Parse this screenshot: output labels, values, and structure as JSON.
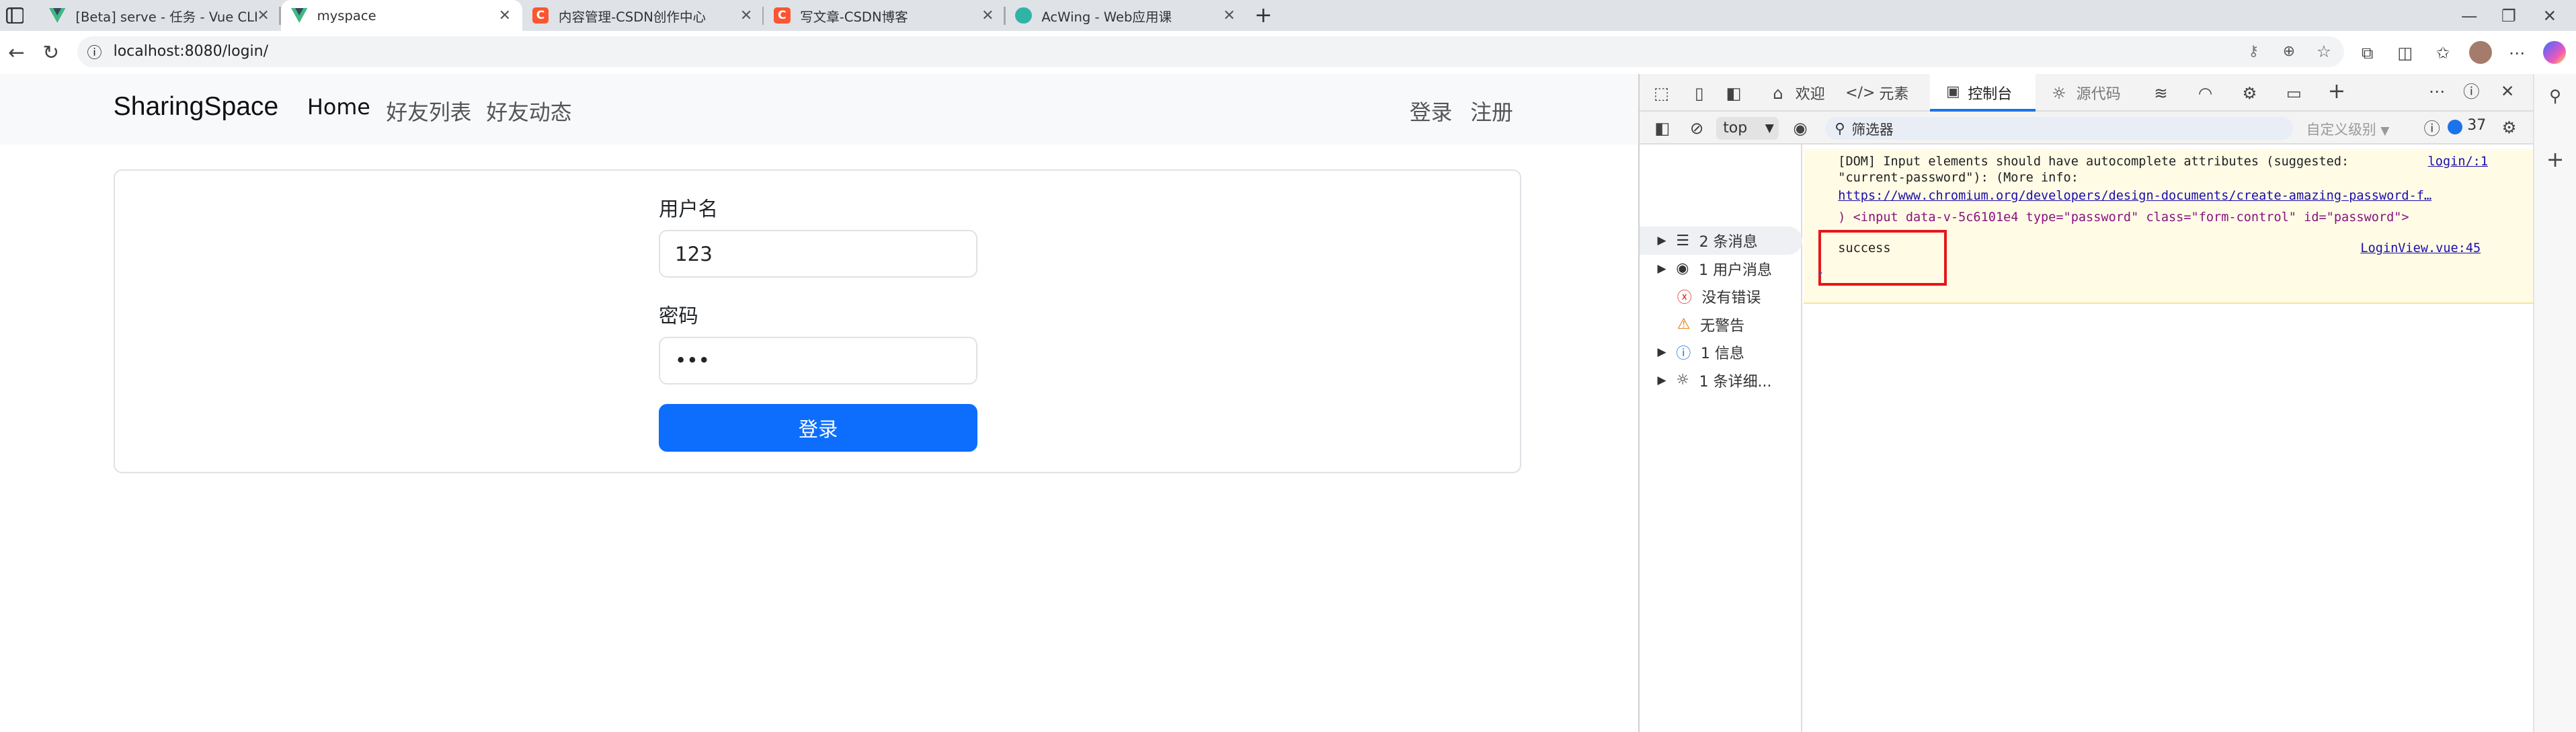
{
  "browser": {
    "tabs": [
      {
        "title": "[Beta] serve - 任务 - Vue CLI",
        "icon": "vue-icon"
      },
      {
        "title": "myspace",
        "icon": "vue-icon"
      },
      {
        "title": "内容管理-CSDN创作中心",
        "icon": "csdn-icon"
      },
      {
        "title": "写文章-CSDN博客",
        "icon": "csdn-icon"
      },
      {
        "title": "AcWing - Web应用课",
        "icon": "acwing-icon"
      }
    ],
    "csdn_letter": "C",
    "url": "localhost:8080/login/"
  },
  "page": {
    "brand": "SharingSpace",
    "nav": [
      "Home",
      "好友列表",
      "好友动态"
    ],
    "nav_right": [
      "登录",
      "注册"
    ],
    "username_label": "用户名",
    "username_value": "123",
    "password_label": "密码",
    "password_value": "•••",
    "submit_label": "登录",
    "accent": "#0d6efd"
  },
  "devtools": {
    "tabs": [
      "欢迎",
      "元素",
      "控制台",
      "源代码"
    ],
    "active_tab": "控制台",
    "context": "top",
    "filter_placeholder": "筛选器",
    "level_label": "自定义级别",
    "issue_count": "37",
    "sidebar": [
      {
        "label": "2 条消息",
        "icon": "list-icon"
      },
      {
        "label": "1 用户消息",
        "icon": "user-icon"
      },
      {
        "label": "没有错误",
        "icon": "error-icon"
      },
      {
        "label": "无警告",
        "icon": "warning-icon"
      },
      {
        "label": "1 信息",
        "icon": "info-icon"
      },
      {
        "label": "1 条详细...",
        "icon": "bug-icon"
      }
    ],
    "warning": {
      "line1": "[DOM] Input elements should have autocomplete attributes (suggested:",
      "line2": "\"current-password\"): (More info:",
      "link": "https://www.chromium.org/developers/design-documents/create-amazing-password-f…",
      "line4": ")  <input data-v-5c6101e4 type=\"password\" class=\"form-control\" id=\"password\">",
      "source": "login/:1"
    },
    "log": {
      "text": "success",
      "source": "LoginView.vue:45"
    }
  }
}
